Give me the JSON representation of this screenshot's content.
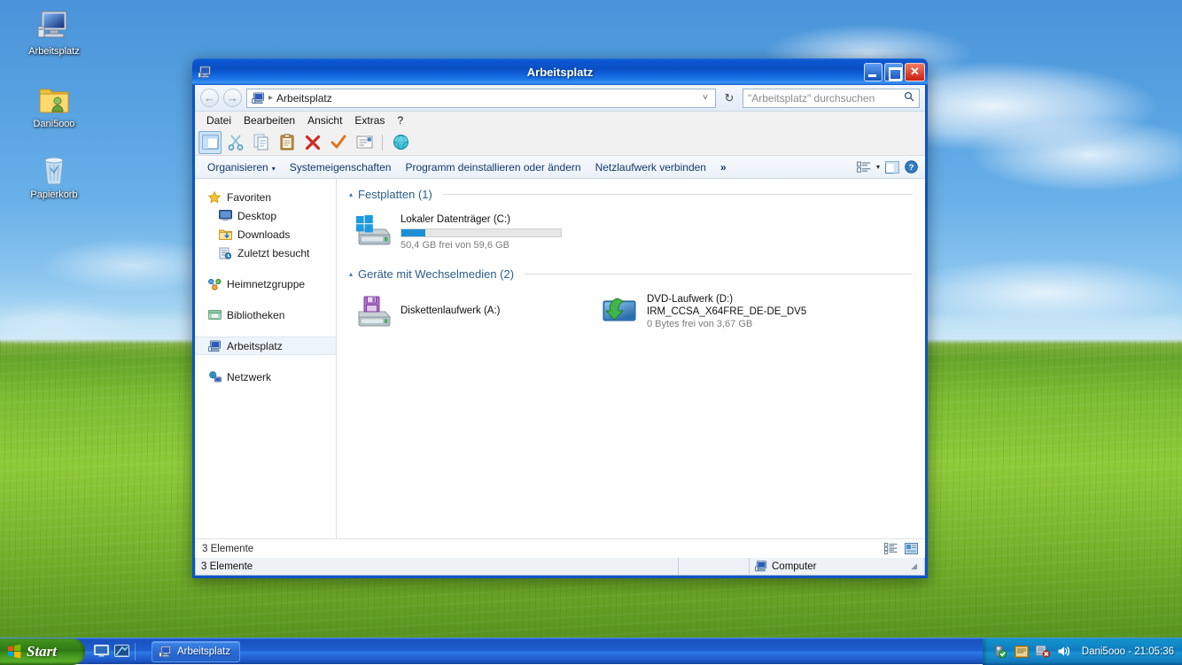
{
  "desktop": {
    "icons": [
      {
        "name": "Arbeitsplatz",
        "icon": "computer-icon"
      },
      {
        "name": "Dani5ooo",
        "icon": "user-folder-icon"
      },
      {
        "name": "Papierkorb",
        "icon": "recycle-bin-icon"
      }
    ]
  },
  "window": {
    "title": "Arbeitsplatz",
    "icon": "computer-icon",
    "controls": {
      "minimize": "Minimieren",
      "maximize": "Maximieren",
      "close": "Schließen"
    },
    "address": {
      "back": "Zurück",
      "forward": "Vorwärts",
      "crumb_icon": "computer-icon",
      "separator": "▸",
      "path": "Arbeitsplatz",
      "dropdown": "˅",
      "refresh": "↻",
      "search_placeholder": "\"Arbeitsplatz\" durchsuchen",
      "search_value": "",
      "search_icon": "search-icon"
    },
    "menu": [
      "Datei",
      "Bearbeiten",
      "Ansicht",
      "Extras",
      "?"
    ],
    "toolbar_icons": [
      "folders-pane-icon",
      "cut-icon",
      "copy-icon",
      "paste-icon",
      "delete-icon",
      "confirm-icon",
      "rename-icon",
      "separator",
      "internet-icon"
    ],
    "commandbar": {
      "organize": "Organisieren",
      "organize_caret": "▾",
      "system_properties": "Systemeigenschaften",
      "uninstall": "Programm deinstallieren oder ändern",
      "map_drive": "Netzlaufwerk verbinden",
      "overflow": "»",
      "view_icon": "view-options-icon",
      "view_caret": "▾",
      "preview_icon": "preview-pane-icon",
      "help_icon": "help-icon"
    },
    "navpane": [
      {
        "label": "Favoriten",
        "icon": "favorites-star-icon",
        "level": 0,
        "selected": false,
        "gap_before": false
      },
      {
        "label": "Desktop",
        "icon": "desktop-icon",
        "level": 1,
        "selected": false,
        "gap_before": false
      },
      {
        "label": "Downloads",
        "icon": "downloads-icon",
        "level": 1,
        "selected": false,
        "gap_before": false
      },
      {
        "label": "Zuletzt besucht",
        "icon": "recent-places-icon",
        "level": 1,
        "selected": false,
        "gap_before": false
      },
      {
        "label": "Heimnetzgruppe",
        "icon": "homegroup-icon",
        "level": 0,
        "selected": false,
        "gap_before": true
      },
      {
        "label": "Bibliotheken",
        "icon": "libraries-icon",
        "level": 0,
        "selected": false,
        "gap_before": true
      },
      {
        "label": "Arbeitsplatz",
        "icon": "computer-icon",
        "level": 0,
        "selected": true,
        "gap_before": true
      },
      {
        "label": "Netzwerk",
        "icon": "network-icon",
        "level": 0,
        "selected": false,
        "gap_before": true
      }
    ],
    "groups": [
      {
        "title": "Festplatten (1)",
        "triangle": "▴",
        "items": [
          {
            "icon": "hdd-windows-icon",
            "name": "Lokaler Datenträger (C:)",
            "sub": "50,4 GB frei von 59,6 GB",
            "has_bar": true,
            "bar_percent": 15
          }
        ]
      },
      {
        "title": "Geräte mit Wechselmedien (2)",
        "triangle": "▴",
        "items": [
          {
            "icon": "floppy-drive-icon",
            "name": "Diskettenlaufwerk (A:)",
            "sub": "",
            "has_bar": false,
            "bar_percent": 0
          },
          {
            "icon": "dvd-drive-icon",
            "name": "DVD-Laufwerk (D:)",
            "sub": "IRM_CCSA_X64FRE_DE-DE_DV5",
            "sub2": "0 Bytes frei von 3,67 GB",
            "has_bar": false,
            "bar_percent": 0
          }
        ]
      }
    ],
    "details": {
      "count": "3 Elemente",
      "view_list_icon": "details-view-icon",
      "view_tiles_icon": "tiles-view-icon"
    },
    "statusbar": {
      "count": "3 Elemente",
      "middle": "",
      "computer_icon": "computer-icon",
      "computer": "Computer"
    }
  },
  "taskbar": {
    "start": "Start",
    "start_icon": "windows-flag-icon",
    "quicklaunch": [
      {
        "icon": "show-desktop-icon",
        "name": "Desktop anzeigen"
      },
      {
        "icon": "media-player-icon",
        "name": "Media Player"
      }
    ],
    "tasks": [
      {
        "label": "Arbeitsplatz",
        "icon": "computer-icon",
        "active": true
      }
    ],
    "tray": {
      "icons": [
        "security-shield-icon",
        "virtualbox-icon",
        "network-error-icon",
        "volume-icon"
      ],
      "clock": "Dani5ooo - 21:05:36"
    }
  },
  "colors": {
    "titlebar_blue": "#0b54c8",
    "accent_blue": "#1e8fd6",
    "taskbar_blue": "#1e5fd0",
    "start_green": "#3d8c1c",
    "group_heading": "#2b5c8a",
    "close_red": "#cc2010"
  }
}
